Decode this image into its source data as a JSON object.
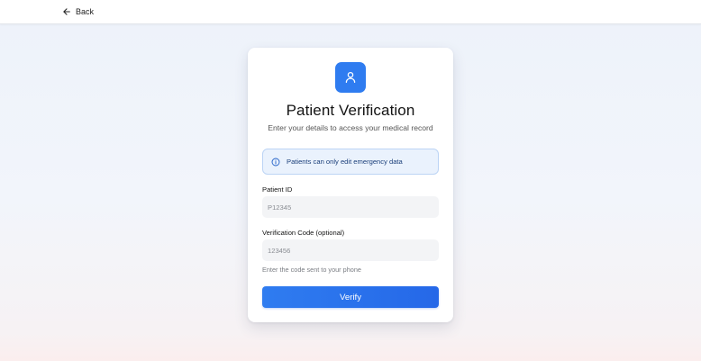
{
  "header": {
    "back_label": "Back"
  },
  "card": {
    "title": "Patient Verification",
    "subtitle": "Enter your details to access your medical record",
    "notice": "Patients can only edit emergency data",
    "patient_id": {
      "label": "Patient ID",
      "value": "",
      "placeholder": "P12345"
    },
    "verification_code": {
      "label": "Verification Code (optional)",
      "value": "",
      "placeholder": "123456",
      "hint": "Enter the code sent to your phone"
    },
    "submit_label": "Verify"
  },
  "icons": {
    "back": "arrow-left-icon",
    "badge": "user-icon",
    "notice": "info-icon"
  },
  "colors": {
    "accent": "#2f7cf0",
    "notice_bg": "#eaf2fd",
    "notice_border": "#bcd4f5",
    "notice_text": "#1b3f7a"
  }
}
